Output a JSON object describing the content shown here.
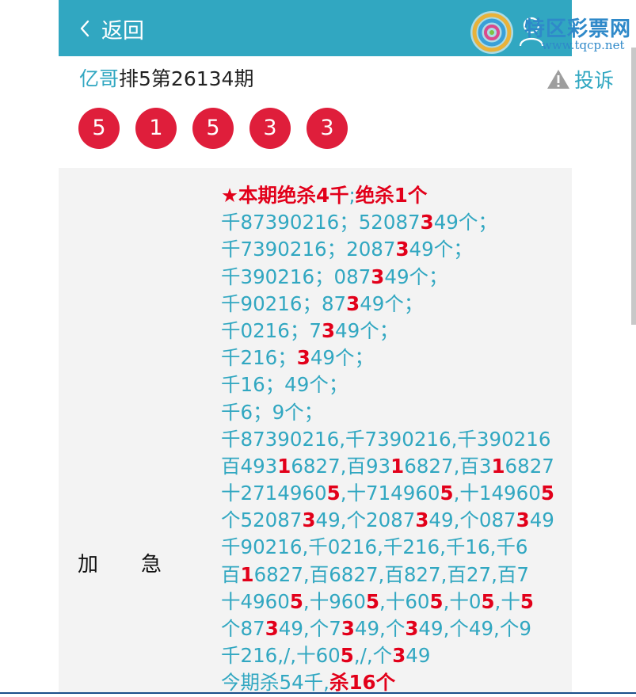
{
  "header": {
    "back_label": "返回",
    "bg_color": "#31a7c1"
  },
  "logo": {
    "text": "特区彩票网",
    "sub": "www.tqcp.net"
  },
  "title": {
    "author": "亿哥",
    "rest": "排5第26134期"
  },
  "report_label": "投诉",
  "balls": [
    "5",
    "1",
    "5",
    "3",
    "3"
  ],
  "ball_color": "#df1e3b",
  "row_label": [
    "加",
    "急"
  ],
  "content_lines": [
    [
      {
        "t": "★本期绝杀4千",
        "r": true
      },
      {
        "t": ";",
        "r": false
      },
      {
        "t": "绝杀1个",
        "r": true
      }
    ],
    [
      {
        "t": "千87390216；52087",
        "r": false
      },
      {
        "t": "3",
        "r": true
      },
      {
        "t": "49个；",
        "r": false
      }
    ],
    [
      {
        "t": "千7390216；2087",
        "r": false
      },
      {
        "t": "3",
        "r": true
      },
      {
        "t": "49个；",
        "r": false
      }
    ],
    [
      {
        "t": "千390216；087",
        "r": false
      },
      {
        "t": "3",
        "r": true
      },
      {
        "t": "49个；",
        "r": false
      }
    ],
    [
      {
        "t": "千90216；87",
        "r": false
      },
      {
        "t": "3",
        "r": true
      },
      {
        "t": "49个；",
        "r": false
      }
    ],
    [
      {
        "t": "千0216；7",
        "r": false
      },
      {
        "t": "3",
        "r": true
      },
      {
        "t": "49个；",
        "r": false
      }
    ],
    [
      {
        "t": "千216；",
        "r": false
      },
      {
        "t": "3",
        "r": true
      },
      {
        "t": "49个；",
        "r": false
      }
    ],
    [
      {
        "t": "千16；49个；",
        "r": false
      }
    ],
    [
      {
        "t": "千6；9个；",
        "r": false
      }
    ],
    [
      {
        "t": "千87390216,千7390216,千390216",
        "r": false
      }
    ],
    [
      {
        "t": "百493",
        "r": false
      },
      {
        "t": "1",
        "r": true
      },
      {
        "t": "6827,百93",
        "r": false
      },
      {
        "t": "1",
        "r": true
      },
      {
        "t": "6827,百3",
        "r": false
      },
      {
        "t": "1",
        "r": true
      },
      {
        "t": "6827",
        "r": false
      }
    ],
    [
      {
        "t": "十2714960",
        "r": false
      },
      {
        "t": "5",
        "r": true
      },
      {
        "t": ",十714960",
        "r": false
      },
      {
        "t": "5",
        "r": true
      },
      {
        "t": ",十14960",
        "r": false
      },
      {
        "t": "5",
        "r": true
      }
    ],
    [
      {
        "t": "个52087",
        "r": false
      },
      {
        "t": "3",
        "r": true
      },
      {
        "t": "49,个2087",
        "r": false
      },
      {
        "t": "3",
        "r": true
      },
      {
        "t": "49,个087",
        "r": false
      },
      {
        "t": "3",
        "r": true
      },
      {
        "t": "49",
        "r": false
      }
    ],
    [
      {
        "t": "千90216,千0216,千216,千16,千6",
        "r": false
      }
    ],
    [
      {
        "t": "百",
        "r": false
      },
      {
        "t": "1",
        "r": true
      },
      {
        "t": "6827,百6827,百827,百27,百7",
        "r": false
      }
    ],
    [
      {
        "t": "十4960",
        "r": false
      },
      {
        "t": "5",
        "r": true
      },
      {
        "t": ",十960",
        "r": false
      },
      {
        "t": "5",
        "r": true
      },
      {
        "t": ",十60",
        "r": false
      },
      {
        "t": "5",
        "r": true
      },
      {
        "t": ",十0",
        "r": false
      },
      {
        "t": "5",
        "r": true
      },
      {
        "t": ",十",
        "r": false
      },
      {
        "t": "5",
        "r": true
      }
    ],
    [
      {
        "t": "个87",
        "r": false
      },
      {
        "t": "3",
        "r": true
      },
      {
        "t": "49,个7",
        "r": false
      },
      {
        "t": "3",
        "r": true
      },
      {
        "t": "49,个",
        "r": false
      },
      {
        "t": "3",
        "r": true
      },
      {
        "t": "49,个49,个9",
        "r": false
      }
    ],
    [
      {
        "t": "千216,/,十60",
        "r": false
      },
      {
        "t": "5",
        "r": true
      },
      {
        "t": ",/,个",
        "r": false
      },
      {
        "t": "3",
        "r": true
      },
      {
        "t": "49",
        "r": false
      }
    ],
    [
      {
        "t": "今期杀54千,",
        "r": false
      },
      {
        "t": "杀16个",
        "r": true
      }
    ]
  ]
}
